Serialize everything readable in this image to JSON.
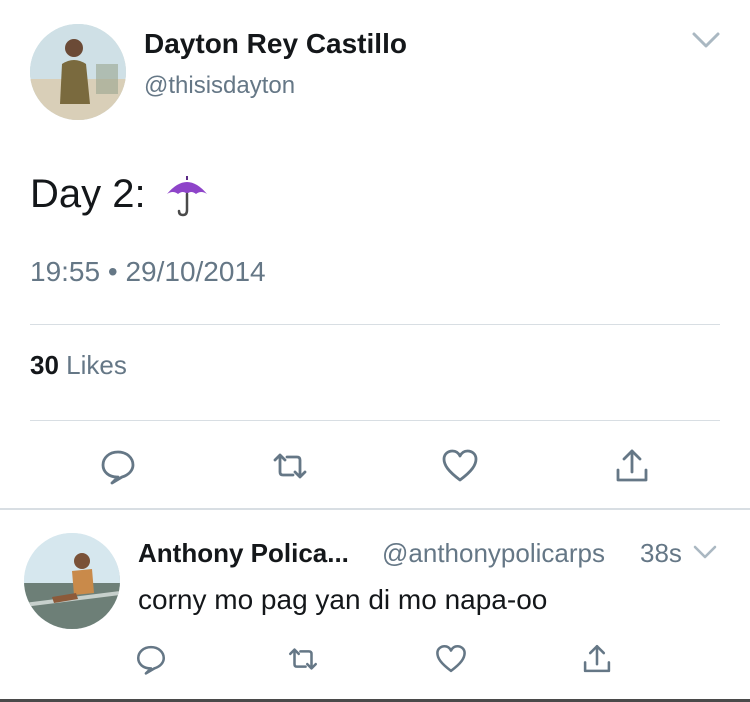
{
  "tweet": {
    "author_name": "Dayton Rey Castillo",
    "author_handle": "@thisisdayton",
    "text": "Day 2:",
    "emoji": "☂️",
    "time": "19:55",
    "separator": "•",
    "date": "29/10/2014",
    "likes_count": "30",
    "likes_label": "Likes",
    "menu_icon": "chevron-down-icon"
  },
  "reply": {
    "author_name": "Anthony Polica...",
    "author_handle": "@anthonypolicarps",
    "time_ago": "38s",
    "text": "corny mo pag yan di mo napa-oo",
    "menu_icon": "chevron-down-icon"
  },
  "actions": [
    "reply-icon",
    "retweet-icon",
    "like-icon",
    "share-icon"
  ],
  "colors": {
    "text_primary": "#14171a",
    "text_secondary": "#657786",
    "icon": "#657786",
    "divider": "#d8dee3",
    "chevron": "#aab8c2"
  }
}
